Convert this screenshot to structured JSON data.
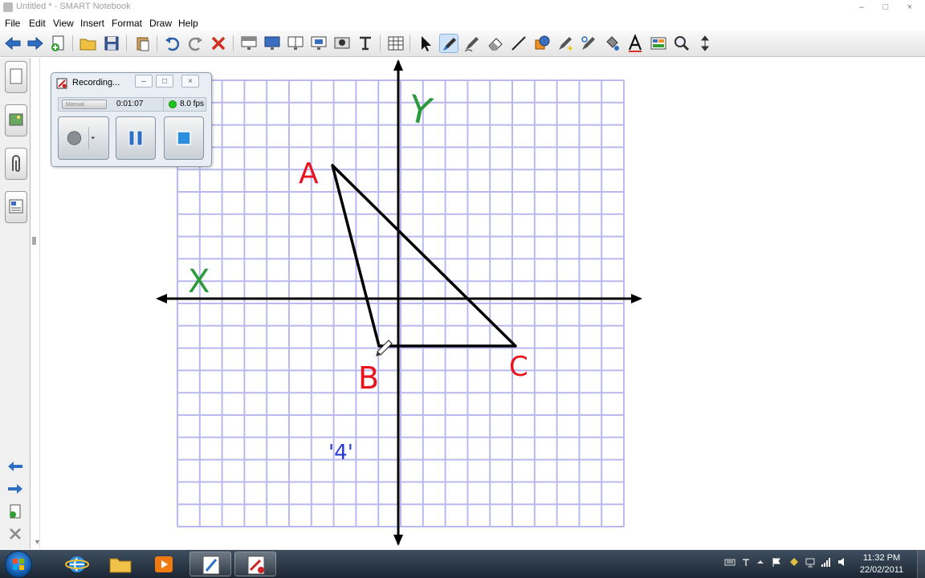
{
  "window": {
    "title": "Untitled * - SMART Notebook",
    "minimize_label": "–",
    "maximize_label": "□",
    "close_label": "×"
  },
  "menu": {
    "items": [
      "File",
      "Edit",
      "View",
      "Insert",
      "Format",
      "Draw",
      "Help"
    ]
  },
  "toolbar": {
    "tools": [
      "back-arrow",
      "forward-arrow",
      "add-page",
      "open-file",
      "save",
      "paste",
      "undo",
      "redo",
      "delete",
      "screen-shade",
      "full-screen",
      "dual-page",
      "screen-capture",
      "screen-capture-area",
      "document-camera",
      "table",
      "select-pointer",
      "pen",
      "creative-pen",
      "eraser",
      "line",
      "shape",
      "magic-pen",
      "shape-recognition-pen",
      "fill",
      "text",
      "properties",
      "magnifier",
      "move-toolbar"
    ],
    "active_tool": "pen"
  },
  "sidebar": {
    "tabs": [
      "page-sorter",
      "gallery",
      "attachments",
      "properties"
    ],
    "bottom_buttons": [
      "previous-page",
      "next-page",
      "add-page",
      "delete-page"
    ]
  },
  "recorder": {
    "title": "Recording...",
    "mode_label": "Manual",
    "elapsed_time": "0:01:07",
    "fps_label": "8.0 fps",
    "buttons": [
      "record",
      "pause",
      "stop"
    ],
    "status_color": "#22c422"
  },
  "whiteboard": {
    "grid_color": "#b9b9f0",
    "vertex_labels": [
      {
        "text": "A",
        "color": "#e8141e"
      },
      {
        "text": "B",
        "color": "#e8141e"
      },
      {
        "text": "C",
        "color": "#e8141e"
      }
    ],
    "axis_labels": [
      {
        "text": "X",
        "color": "#2a9a3a"
      },
      {
        "text": "Y",
        "color": "#2a9a3a"
      }
    ],
    "annotation": {
      "text": "'4'",
      "color": "#2a3ad8"
    }
  },
  "taskbar": {
    "apps": [
      "internet-explorer",
      "windows-explorer",
      "media-player",
      "smart-notebook",
      "smart-recorder"
    ],
    "clock_time": "11:32 PM",
    "clock_date": "22/02/2011"
  }
}
